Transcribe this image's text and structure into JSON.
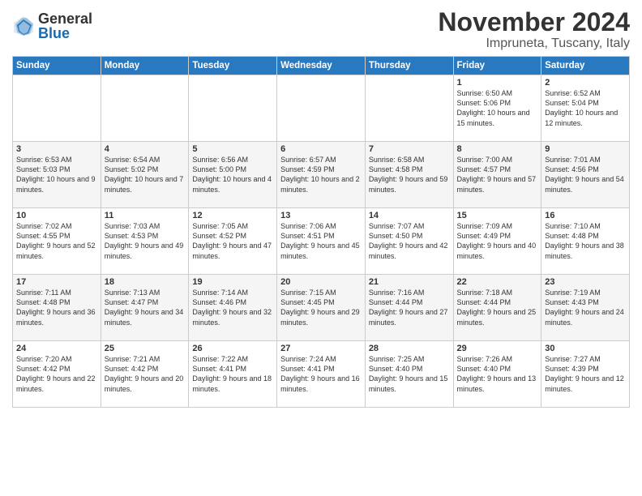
{
  "header": {
    "logo_general": "General",
    "logo_blue": "Blue",
    "month_title": "November 2024",
    "location": "Impruneta, Tuscany, Italy"
  },
  "weekdays": [
    "Sunday",
    "Monday",
    "Tuesday",
    "Wednesday",
    "Thursday",
    "Friday",
    "Saturday"
  ],
  "weeks": [
    [
      {
        "day": "",
        "info": ""
      },
      {
        "day": "",
        "info": ""
      },
      {
        "day": "",
        "info": ""
      },
      {
        "day": "",
        "info": ""
      },
      {
        "day": "",
        "info": ""
      },
      {
        "day": "1",
        "info": "Sunrise: 6:50 AM\nSunset: 5:06 PM\nDaylight: 10 hours and 15 minutes."
      },
      {
        "day": "2",
        "info": "Sunrise: 6:52 AM\nSunset: 5:04 PM\nDaylight: 10 hours and 12 minutes."
      }
    ],
    [
      {
        "day": "3",
        "info": "Sunrise: 6:53 AM\nSunset: 5:03 PM\nDaylight: 10 hours and 9 minutes."
      },
      {
        "day": "4",
        "info": "Sunrise: 6:54 AM\nSunset: 5:02 PM\nDaylight: 10 hours and 7 minutes."
      },
      {
        "day": "5",
        "info": "Sunrise: 6:56 AM\nSunset: 5:00 PM\nDaylight: 10 hours and 4 minutes."
      },
      {
        "day": "6",
        "info": "Sunrise: 6:57 AM\nSunset: 4:59 PM\nDaylight: 10 hours and 2 minutes."
      },
      {
        "day": "7",
        "info": "Sunrise: 6:58 AM\nSunset: 4:58 PM\nDaylight: 9 hours and 59 minutes."
      },
      {
        "day": "8",
        "info": "Sunrise: 7:00 AM\nSunset: 4:57 PM\nDaylight: 9 hours and 57 minutes."
      },
      {
        "day": "9",
        "info": "Sunrise: 7:01 AM\nSunset: 4:56 PM\nDaylight: 9 hours and 54 minutes."
      }
    ],
    [
      {
        "day": "10",
        "info": "Sunrise: 7:02 AM\nSunset: 4:55 PM\nDaylight: 9 hours and 52 minutes."
      },
      {
        "day": "11",
        "info": "Sunrise: 7:03 AM\nSunset: 4:53 PM\nDaylight: 9 hours and 49 minutes."
      },
      {
        "day": "12",
        "info": "Sunrise: 7:05 AM\nSunset: 4:52 PM\nDaylight: 9 hours and 47 minutes."
      },
      {
        "day": "13",
        "info": "Sunrise: 7:06 AM\nSunset: 4:51 PM\nDaylight: 9 hours and 45 minutes."
      },
      {
        "day": "14",
        "info": "Sunrise: 7:07 AM\nSunset: 4:50 PM\nDaylight: 9 hours and 42 minutes."
      },
      {
        "day": "15",
        "info": "Sunrise: 7:09 AM\nSunset: 4:49 PM\nDaylight: 9 hours and 40 minutes."
      },
      {
        "day": "16",
        "info": "Sunrise: 7:10 AM\nSunset: 4:48 PM\nDaylight: 9 hours and 38 minutes."
      }
    ],
    [
      {
        "day": "17",
        "info": "Sunrise: 7:11 AM\nSunset: 4:48 PM\nDaylight: 9 hours and 36 minutes."
      },
      {
        "day": "18",
        "info": "Sunrise: 7:13 AM\nSunset: 4:47 PM\nDaylight: 9 hours and 34 minutes."
      },
      {
        "day": "19",
        "info": "Sunrise: 7:14 AM\nSunset: 4:46 PM\nDaylight: 9 hours and 32 minutes."
      },
      {
        "day": "20",
        "info": "Sunrise: 7:15 AM\nSunset: 4:45 PM\nDaylight: 9 hours and 29 minutes."
      },
      {
        "day": "21",
        "info": "Sunrise: 7:16 AM\nSunset: 4:44 PM\nDaylight: 9 hours and 27 minutes."
      },
      {
        "day": "22",
        "info": "Sunrise: 7:18 AM\nSunset: 4:44 PM\nDaylight: 9 hours and 25 minutes."
      },
      {
        "day": "23",
        "info": "Sunrise: 7:19 AM\nSunset: 4:43 PM\nDaylight: 9 hours and 24 minutes."
      }
    ],
    [
      {
        "day": "24",
        "info": "Sunrise: 7:20 AM\nSunset: 4:42 PM\nDaylight: 9 hours and 22 minutes."
      },
      {
        "day": "25",
        "info": "Sunrise: 7:21 AM\nSunset: 4:42 PM\nDaylight: 9 hours and 20 minutes."
      },
      {
        "day": "26",
        "info": "Sunrise: 7:22 AM\nSunset: 4:41 PM\nDaylight: 9 hours and 18 minutes."
      },
      {
        "day": "27",
        "info": "Sunrise: 7:24 AM\nSunset: 4:41 PM\nDaylight: 9 hours and 16 minutes."
      },
      {
        "day": "28",
        "info": "Sunrise: 7:25 AM\nSunset: 4:40 PM\nDaylight: 9 hours and 15 minutes."
      },
      {
        "day": "29",
        "info": "Sunrise: 7:26 AM\nSunset: 4:40 PM\nDaylight: 9 hours and 13 minutes."
      },
      {
        "day": "30",
        "info": "Sunrise: 7:27 AM\nSunset: 4:39 PM\nDaylight: 9 hours and 12 minutes."
      }
    ]
  ]
}
